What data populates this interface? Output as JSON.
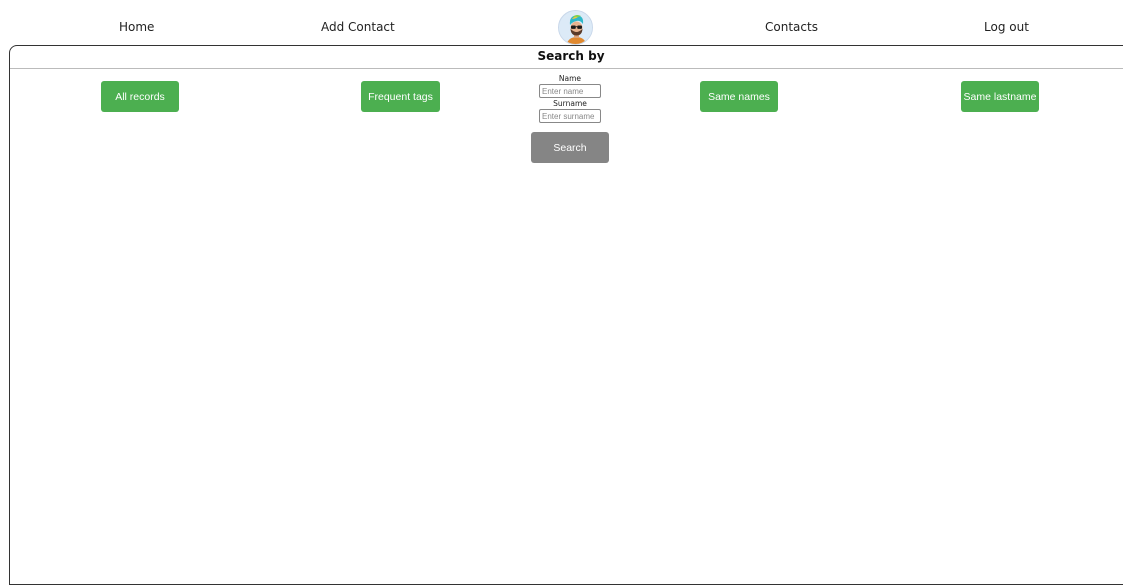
{
  "nav": {
    "home": "Home",
    "add_contact": "Add Contact",
    "contacts": "Contacts",
    "log_out": "Log out",
    "avatar_icon": "user-avatar-icon"
  },
  "panel": {
    "title": "Search by"
  },
  "filters": {
    "all_records": "All records",
    "frequent_tags": "Frequent tags",
    "same_names": "Same names",
    "same_lastname": "Same lastname"
  },
  "search": {
    "name_label": "Name",
    "name_placeholder": "Enter name",
    "name_value": "",
    "surname_label": "Surname",
    "surname_placeholder": "Enter surname",
    "surname_value": "",
    "button_label": "Search"
  },
  "colors": {
    "green_button": "#4caf50",
    "search_button": "#858585",
    "panel_border": "#333333"
  }
}
